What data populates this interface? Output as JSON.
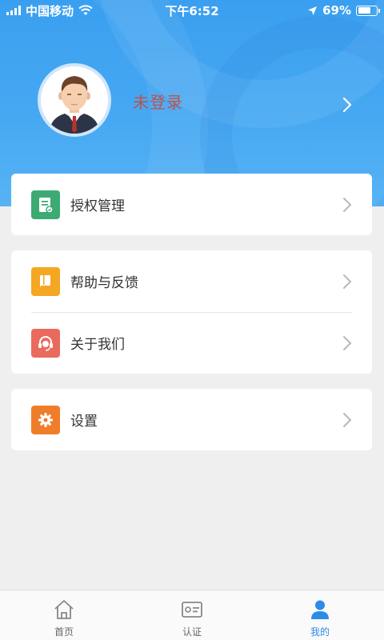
{
  "status_bar": {
    "carrier": "中国移动",
    "time": "下午6:52",
    "battery": "69%",
    "battery_level": 0.69,
    "icons": [
      "signal-icon",
      "wifi-icon",
      "location-arrow-icon",
      "battery-icon"
    ]
  },
  "profile": {
    "login_status": "未登录",
    "avatar": "male-avatar-suit"
  },
  "menu_groups": [
    [
      {
        "label": "授权管理",
        "icon": "authorization-document-icon",
        "color": "#3daa73"
      }
    ],
    [
      {
        "label": "帮助与反馈",
        "icon": "help-book-icon",
        "color": "#f5a623"
      },
      {
        "label": "关于我们",
        "icon": "headset-icon",
        "color": "#ea6a5e"
      }
    ],
    [
      {
        "label": "设置",
        "icon": "settings-gear-icon",
        "color": "#f07d2a"
      }
    ]
  ],
  "tab_bar": {
    "tabs": [
      {
        "label": "首页",
        "icon": "home-icon",
        "active": false
      },
      {
        "label": "认证",
        "icon": "id-card-icon",
        "active": false
      },
      {
        "label": "我的",
        "icon": "person-icon",
        "active": true
      }
    ],
    "active_color": "#2b8be8",
    "inactive_color": "#888888"
  },
  "colors": {
    "header": "#45a6f2",
    "background": "#efefef"
  }
}
